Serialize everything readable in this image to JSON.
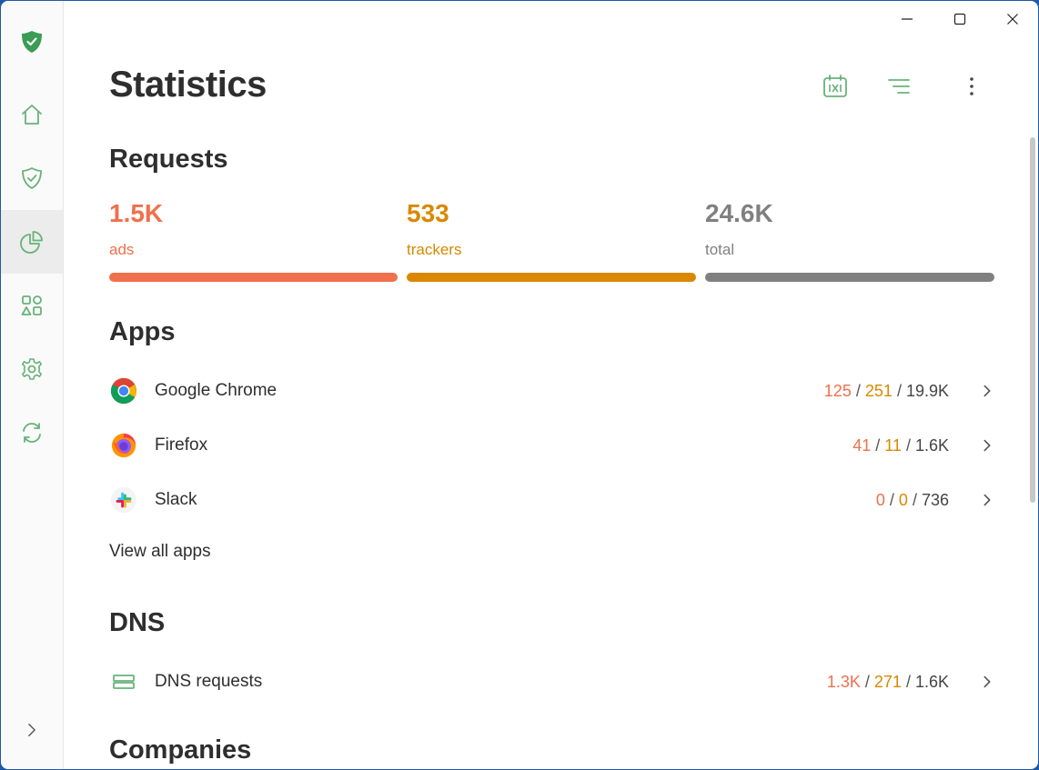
{
  "window": {
    "controls": {
      "minimize": "minimize-icon",
      "maximize": "maximize-icon",
      "close": "close-icon"
    }
  },
  "sidebar": {
    "items": [
      {
        "id": "logo",
        "icon": "adguard-shield-logo"
      },
      {
        "id": "home",
        "icon": "home-icon"
      },
      {
        "id": "protection",
        "icon": "shield-check-icon"
      },
      {
        "id": "statistics",
        "icon": "pie-chart-icon",
        "active": true
      },
      {
        "id": "apps",
        "icon": "apps-grid-icon"
      },
      {
        "id": "settings",
        "icon": "gear-icon"
      },
      {
        "id": "sync",
        "icon": "sync-icon"
      },
      {
        "id": "expand",
        "icon": "chevron-right-icon"
      }
    ]
  },
  "header": {
    "title": "Statistics",
    "tools": [
      "calendar-icon",
      "filter-icon",
      "more-vertical-icon"
    ]
  },
  "requests": {
    "title": "Requests",
    "ads": {
      "value": "1.5K",
      "label": "ads",
      "color": "#f0704c"
    },
    "trackers": {
      "value": "533",
      "label": "trackers",
      "color": "#d98800"
    },
    "total": {
      "value": "24.6K",
      "label": "total",
      "color": "#808080"
    }
  },
  "apps": {
    "title": "Apps",
    "items": [
      {
        "name": "Google Chrome",
        "icon": "chrome-icon",
        "ads": "125",
        "trackers": "251",
        "total": "19.9K"
      },
      {
        "name": "Firefox",
        "icon": "firefox-icon",
        "ads": "41",
        "trackers": "11",
        "total": "1.6K"
      },
      {
        "name": "Slack",
        "icon": "slack-icon",
        "ads": "0",
        "trackers": "0",
        "total": "736"
      }
    ],
    "view_all": "View all apps"
  },
  "dns": {
    "title": "DNS",
    "item": {
      "name": "DNS requests",
      "icon": "server-icon",
      "ads": "1.3K",
      "trackers": "271",
      "total": "1.6K"
    }
  },
  "companies": {
    "title": "Companies"
  },
  "colors": {
    "accent": "#67b279",
    "ads": "#f0704c",
    "trackers": "#d98800",
    "total": "#808080"
  },
  "slash": "/"
}
